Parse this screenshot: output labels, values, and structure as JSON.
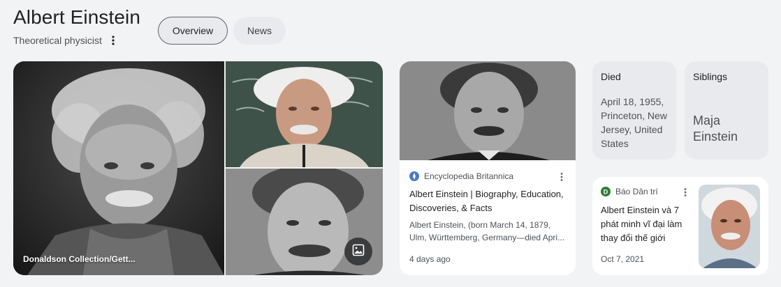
{
  "knowledge_panel": {
    "title": "Albert Einstein",
    "subtitle": "Theoretical physicist",
    "tabs": [
      {
        "label": "Overview",
        "selected": true
      },
      {
        "label": "News",
        "selected": false
      }
    ]
  },
  "images": {
    "main_caption": "Donaldson Collection/Gett...",
    "view_images_icon": "image-gallery-icon"
  },
  "news_card_1": {
    "source": "Encyclopedia Britannica",
    "title": "Albert Einstein | Biography, Education, Discoveries, & Facts",
    "snippet": "Albert Einstein, (born March 14, 1879, Ulm, Württemberg, Germany—died Apri...",
    "time": "4 days ago"
  },
  "facts": {
    "died_label": "Died",
    "died_value": "April 18, 1955, Princeton, New Jersey, United States",
    "siblings_label": "Siblings",
    "siblings_value": "Maja Einstein"
  },
  "news_card_2": {
    "source": "Báo Dân trí",
    "title": "Albert Einstein và 7 phát minh vĩ đại làm thay đổi thế giới",
    "time": "Oct 7, 2021"
  },
  "colors": {
    "background": "#f1f3f4",
    "chip_bg": "#e8eaed",
    "dantri_green": "#2e7d32",
    "britannica_blue": "#4a7bbf"
  }
}
